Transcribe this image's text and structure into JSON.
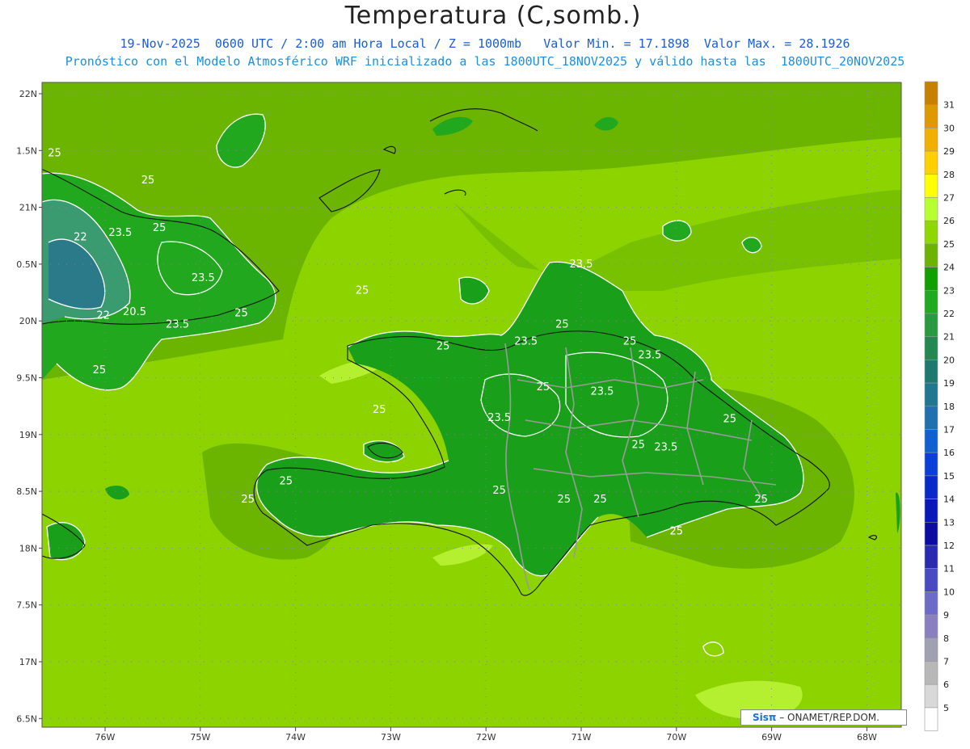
{
  "title": "Temperatura (C,somb.)",
  "subtitle_line1": "19-Nov-2025  0600 UTC / 2:00 am Hora Local / Z = 1000mb   Valor Min. = 17.1898  Valor Max. = 28.1926",
  "subtitle_line2": "Pronóstico con el Modelo Atmosférico WRF inicializado a las 1800UTC_18NOV2025 y válido hasta las  1800UTC_20NOV2025",
  "credit": {
    "logo": "Sisπ",
    "text": "– ONAMET/REP.DOM."
  },
  "map": {
    "lat_labels": [
      "22N",
      "1.5N",
      "21N",
      "0.5N",
      "20N",
      "9.5N",
      "19N",
      "8.5N",
      "18N",
      "7.5N",
      "17N",
      "6.5N"
    ],
    "lon_labels": [
      "76W",
      "75W",
      "74W",
      "73W",
      "72W",
      "71W",
      "70W",
      "69W",
      "68W"
    ],
    "contour_labels": [
      {
        "text": "25",
        "lon": -76.53,
        "lat": 21.45
      },
      {
        "text": "25",
        "lon": -75.55,
        "lat": 21.21
      },
      {
        "text": "22",
        "lon": -76.26,
        "lat": 20.71
      },
      {
        "text": "23.5",
        "lon": -75.84,
        "lat": 20.75
      },
      {
        "text": "25",
        "lon": -75.43,
        "lat": 20.79
      },
      {
        "text": "23.5",
        "lon": -74.97,
        "lat": 20.35
      },
      {
        "text": "20.5",
        "lon": -75.69,
        "lat": 20.05
      },
      {
        "text": "22",
        "lon": -76.02,
        "lat": 20.02
      },
      {
        "text": "23.5",
        "lon": -75.24,
        "lat": 19.94
      },
      {
        "text": "25",
        "lon": -74.57,
        "lat": 20.04
      },
      {
        "text": "25",
        "lon": -76.06,
        "lat": 19.54
      },
      {
        "text": "25",
        "lon": -73.3,
        "lat": 20.24
      },
      {
        "text": "23.5",
        "lon": -71.0,
        "lat": 20.47
      },
      {
        "text": "25",
        "lon": -71.2,
        "lat": 19.94
      },
      {
        "text": "25",
        "lon": -72.45,
        "lat": 19.75
      },
      {
        "text": "23.5",
        "lon": -71.58,
        "lat": 19.79
      },
      {
        "text": "25",
        "lon": -70.49,
        "lat": 19.79
      },
      {
        "text": "23.5",
        "lon": -70.28,
        "lat": 19.67
      },
      {
        "text": "25",
        "lon": -71.4,
        "lat": 19.39
      },
      {
        "text": "23.5",
        "lon": -70.78,
        "lat": 19.35
      },
      {
        "text": "25",
        "lon": -73.12,
        "lat": 19.19
      },
      {
        "text": "23.5",
        "lon": -71.86,
        "lat": 19.12
      },
      {
        "text": "25",
        "lon": -69.44,
        "lat": 19.11
      },
      {
        "text": "25",
        "lon": -70.4,
        "lat": 18.88
      },
      {
        "text": "23.5",
        "lon": -70.11,
        "lat": 18.86
      },
      {
        "text": "25",
        "lon": -74.1,
        "lat": 18.56
      },
      {
        "text": "25",
        "lon": -74.5,
        "lat": 18.4
      },
      {
        "text": "25",
        "lon": -71.86,
        "lat": 18.48
      },
      {
        "text": "25",
        "lon": -71.18,
        "lat": 18.4
      },
      {
        "text": "25",
        "lon": -70.8,
        "lat": 18.4
      },
      {
        "text": "25",
        "lon": -69.11,
        "lat": 18.4
      },
      {
        "text": "25",
        "lon": -70.0,
        "lat": 18.12
      }
    ]
  },
  "colorbar": {
    "labels": [
      "31",
      "30",
      "29",
      "28",
      "27",
      "26",
      "25",
      "24",
      "23",
      "22",
      "21",
      "20",
      "19",
      "18",
      "17",
      "16",
      "15",
      "14",
      "13",
      "12",
      "11",
      "10",
      "9",
      "8",
      "7",
      "6",
      "5"
    ],
    "colors": [
      "#c88000",
      "#e09800",
      "#f0b000",
      "#ffd000",
      "#ffff00",
      "#b8ff30",
      "#8ed800",
      "#6cb400",
      "#10a000",
      "#20aa20",
      "#2a9a40",
      "#228a50",
      "#1e7a70",
      "#207890",
      "#2070b0",
      "#1060d0",
      "#0a40d8",
      "#0828c8",
      "#0a18b8",
      "#0c0ca0",
      "#2a2ab0",
      "#4a4ac0",
      "#6c6cc8",
      "#8a80c0",
      "#a0a0b0",
      "#b8b8b8",
      "#d8d8d8",
      "#ffffff"
    ]
  }
}
